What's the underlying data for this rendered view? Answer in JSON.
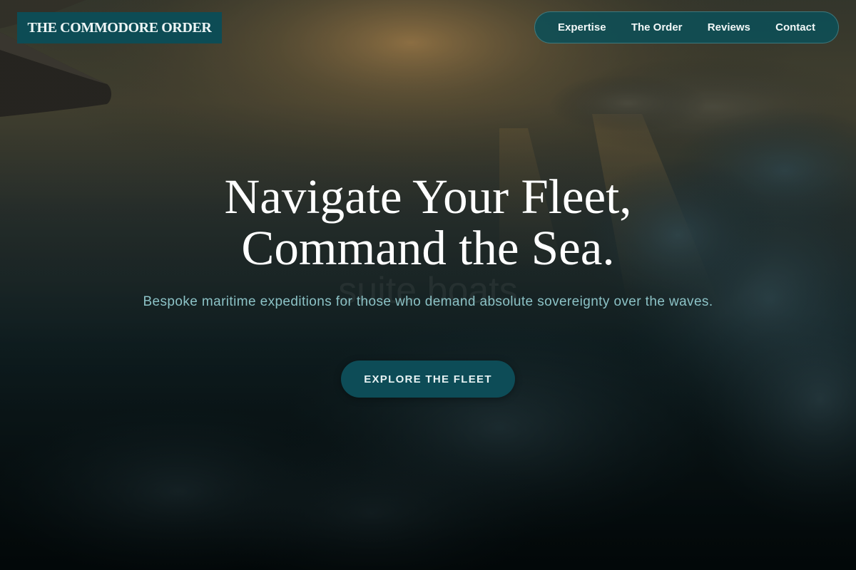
{
  "brand": {
    "name": "THE COMMODORE ORDER"
  },
  "nav": {
    "items": [
      {
        "label": "Expertise"
      },
      {
        "label": "The Order"
      },
      {
        "label": "Reviews"
      },
      {
        "label": "Contact"
      }
    ]
  },
  "hero": {
    "headline_line1": "Navigate Your Fleet,",
    "headline_line2": "Command the Sea.",
    "tagline": "Bespoke maritime expeditions for those who demand absolute sovereignty over the waves.",
    "watermark": "suite boats",
    "cta_label": "EXPLORE THE FLEET",
    "background_description": "sunset-above-clouds-with-airplane-wing"
  },
  "colors": {
    "brand_bg": "#0d4c55",
    "nav_bg": "#0c4e56",
    "cta_bg": "#0d4c57",
    "tagline_text": "#8cc2c6",
    "headline_text": "#ffffff",
    "page_dark": "#061619"
  }
}
